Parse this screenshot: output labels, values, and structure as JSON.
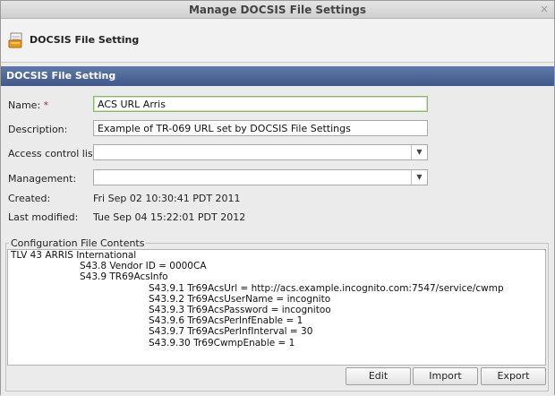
{
  "window": {
    "title": "Manage DOCSIS File Settings",
    "close_glyph": "×"
  },
  "header": {
    "title": "DOCSIS File Setting",
    "icon": "docsis-file-icon"
  },
  "panel": {
    "title": "DOCSIS File Setting"
  },
  "form": {
    "name_label": "Name:",
    "required_mark": "*",
    "name_value": "ACS URL Arris",
    "description_label": "Description:",
    "description_value": "Example of TR-069 URL set by DOCSIS File Settings",
    "acl_label": "Access control list:",
    "acl_value": "",
    "management_label": "Management:",
    "management_value": "",
    "created_label": "Created:",
    "created_value": "Fri Sep 02 10:30:41 PDT 2011",
    "modified_label": "Last modified:",
    "modified_value": "Tue Sep 04 15:22:01 PDT 2012",
    "dropdown_glyph": "▼"
  },
  "config": {
    "legend": "Configuration File Contents",
    "lines": [
      "TLV 43 ARRIS International",
      "S43.8 Vendor ID = 0000CA",
      "S43.9 TR69AcsInfo",
      "S43.9.1 Tr69AcsUrl = http://acs.example.incognito.com:7547/service/cwmp",
      "S43.9.2 Tr69AcsUserName = incognito",
      "S43.9.3 Tr69AcsPassword = incognitoo",
      "S43.9.6 Tr69AcsPerInfEnable = 1",
      "S43.9.7 Tr69AcsPerInfInterval = 30",
      "S43.9.30 Tr69CwmpEnable = 1"
    ]
  },
  "buttons": {
    "edit": "Edit",
    "import": "Import",
    "export": "Export"
  },
  "colors": {
    "panel_header": "#4a6396",
    "required": "#d02020",
    "focus_border": "#8cb86a"
  }
}
